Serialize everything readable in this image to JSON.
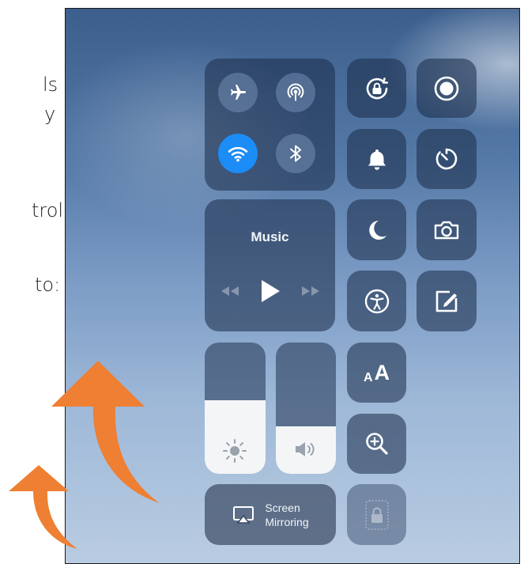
{
  "side_text": {
    "lines": [
      "ls",
      "y",
      "trol",
      "to:"
    ]
  },
  "control_center": {
    "connectivity": {
      "airplane": {
        "icon": "airplane-icon",
        "active": false
      },
      "cellular": {
        "icon": "cellular-data-icon",
        "active": false
      },
      "wifi": {
        "icon": "wifi-icon",
        "active": true
      },
      "bluetooth": {
        "icon": "bluetooth-icon",
        "active": false
      }
    },
    "music": {
      "label": "Music",
      "prev_icon": "rewind-icon",
      "play_icon": "play-icon",
      "next_icon": "fast-forward-icon"
    },
    "toggles": [
      {
        "name": "orientation-lock",
        "icon": "rotation-lock-icon"
      },
      {
        "name": "screen-record",
        "icon": "record-icon"
      },
      {
        "name": "mute",
        "icon": "bell-icon"
      },
      {
        "name": "timer",
        "icon": "timer-icon"
      },
      {
        "name": "do-not-disturb",
        "icon": "moon-icon"
      },
      {
        "name": "camera",
        "icon": "camera-icon"
      },
      {
        "name": "accessibility",
        "icon": "accessibility-icon"
      },
      {
        "name": "notes",
        "icon": "notes-icon"
      },
      {
        "name": "text-size",
        "icon": "text-size-icon"
      },
      {
        "name": "magnifier",
        "icon": "magnifier-icon"
      },
      {
        "name": "guided-access",
        "icon": "lock-icon"
      }
    ],
    "brightness": {
      "level": 0.56,
      "icon": "sun-icon"
    },
    "volume": {
      "level": 0.36,
      "icon": "speaker-icon"
    },
    "text_size_glyph_small": "A",
    "text_size_glyph_large": "A",
    "screen_mirroring": {
      "line1": "Screen",
      "line2": "Mirroring",
      "icon": "airplay-icon"
    }
  },
  "colors": {
    "wifi_active": "#1c8cf6",
    "arrow": "#ee7f33"
  }
}
